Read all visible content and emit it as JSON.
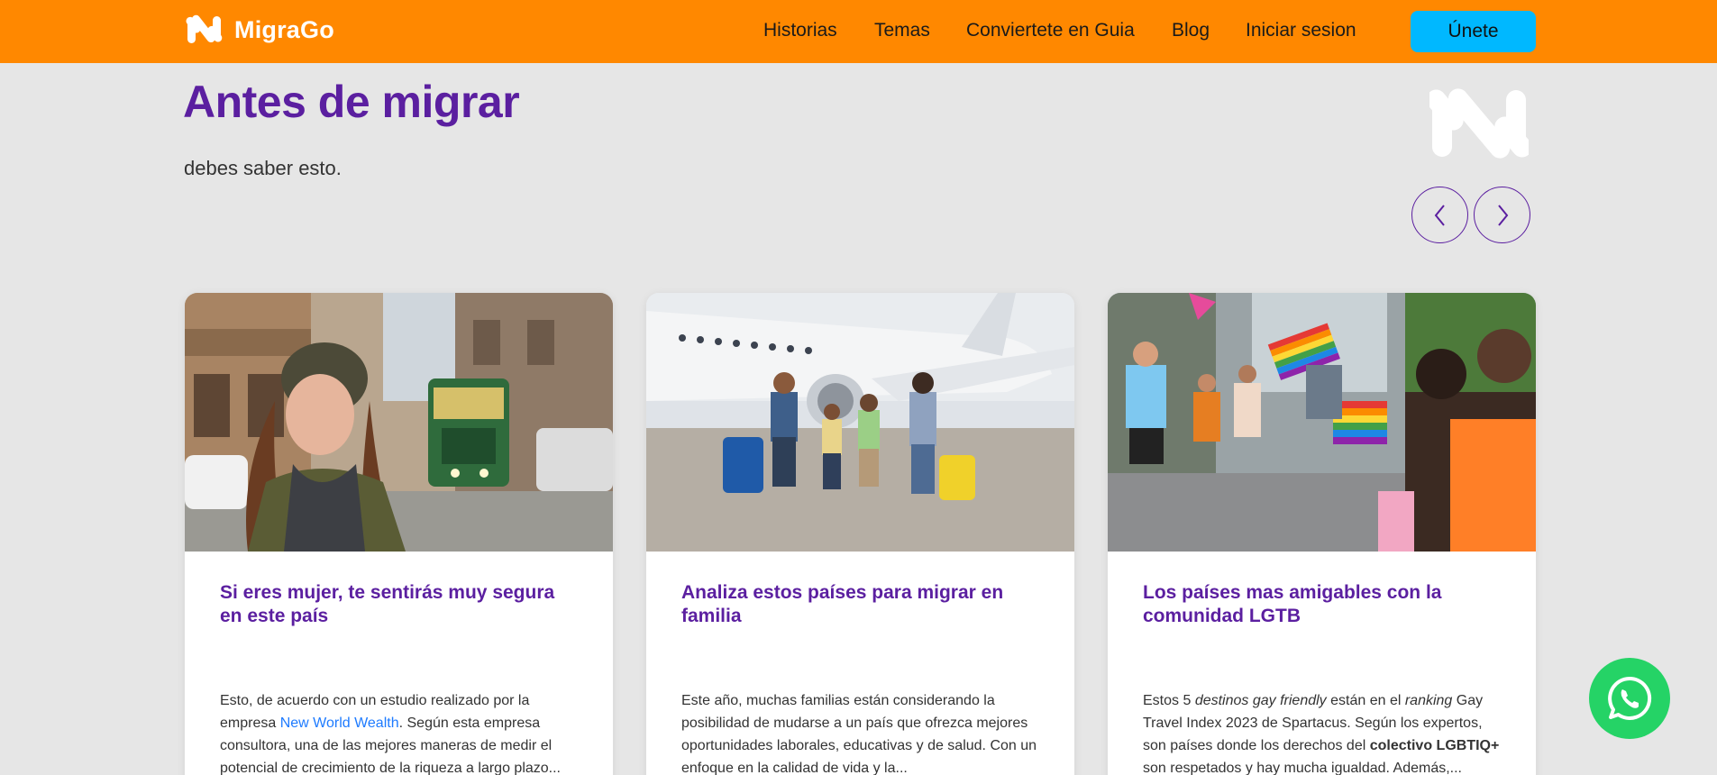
{
  "header": {
    "brand_name": "MigraGo",
    "nav": [
      "Historias",
      "Temas",
      "Conviertete en Guia",
      "Blog",
      "Iniciar sesion"
    ],
    "join_label": "Únete"
  },
  "section": {
    "title": "Antes de migrar",
    "subtitle": "debes saber esto."
  },
  "colors": {
    "header": "#ff8800",
    "accent_purple": "#5b1fa0",
    "join_button": "#00b8ff",
    "link": "#1e7bff",
    "whatsapp": "#25d366"
  },
  "cards": [
    {
      "title": "Si eres mujer, te sentirás muy segura en este país",
      "excerpt": {
        "before": "Esto, de acuerdo con un estudio realizado por la empresa ",
        "link": "New World Wealth",
        "after": ". Según esta empresa consultora, una de las mejores maneras de medir el potencial de crecimiento de la riqueza a largo plazo..."
      }
    },
    {
      "title": "Analiza estos países para migrar en familia",
      "excerpt": "Este año, muchas familias están considerando la posibilidad de mudarse a un país que ofrezca mejores oportunidades laborales, educativas y de salud. Con un enfoque en la calidad de vida y la..."
    },
    {
      "title": "Los países mas amigables con la comunidad LGTB",
      "excerpt": {
        "p1": "Estos 5 ",
        "i1": "destinos gay friendly",
        "p2": " están en el ",
        "i2": "ranking",
        "p3": " Gay Travel Index 2023 de Spartacus. Según los expertos, son países donde los derechos del ",
        "b1": "colectivo LGBTIQ+",
        "p4": " son respetados y hay mucha igualdad. Además,..."
      }
    }
  ],
  "icons": {
    "brand": "migrago-logo-icon",
    "prev": "chevron-left-icon",
    "next": "chevron-right-icon",
    "whatsapp": "whatsapp-icon"
  }
}
